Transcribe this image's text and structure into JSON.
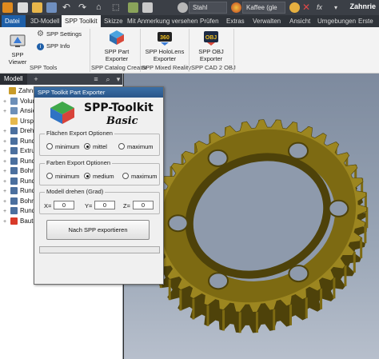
{
  "window": {
    "app_title": "Zahnrie",
    "material_value": "Stahl",
    "appearance_value": "Kaffee (gle"
  },
  "tabs": [
    {
      "label": "Datei"
    },
    {
      "label": "3D-Modell"
    },
    {
      "label": "SPP Toolkit"
    },
    {
      "label": "Skizze"
    },
    {
      "label": "Mit Anmerkung versehen"
    },
    {
      "label": "Prüfen"
    },
    {
      "label": "Extras"
    },
    {
      "label": "Verwalten"
    },
    {
      "label": "Ansicht"
    },
    {
      "label": "Umgebungen"
    },
    {
      "label": "Erste Sch"
    }
  ],
  "ribbon": {
    "spp_viewer": "SPP Viewer",
    "spp_settings": "SPP Settings",
    "spp_info": "SPP Info",
    "spp_part_exporter_1": "SPP Part",
    "spp_part_exporter_2": "Exporter",
    "spp_hololens_1": "SPP HoloLens",
    "spp_hololens_2": "Exporter",
    "spp_obj_1": "SPP OBJ",
    "spp_obj_2": "Exporter",
    "groups": {
      "tools": "SPP Tools",
      "catalog": "SPP Catalog Creator",
      "mixed": "SPP Mixed Reality",
      "cad": "SPP CAD 2 OBJ"
    }
  },
  "browser": {
    "tab_label": "Modell",
    "items": [
      {
        "label": "Zahnrie",
        "color": "#c89b2a"
      },
      {
        "label": "Volun",
        "color": "#6d8fb8"
      },
      {
        "label": "Ansich",
        "color": "#6d8fb8"
      },
      {
        "label": "Urspr",
        "color": "#e6b84c"
      },
      {
        "label": "Drehu",
        "color": "#4b6f9e"
      },
      {
        "label": "Rund",
        "color": "#4b6f9e"
      },
      {
        "label": "Extru",
        "color": "#4b6f9e"
      },
      {
        "label": "Rund",
        "color": "#4b6f9e"
      },
      {
        "label": "Bohru",
        "color": "#4b6f9e"
      },
      {
        "label": "Rund",
        "color": "#4b6f9e"
      },
      {
        "label": "Rund",
        "color": "#4b6f9e"
      },
      {
        "label": "Bohru",
        "color": "#4b6f9e"
      },
      {
        "label": "Rund",
        "color": "#4b6f9e"
      },
      {
        "label": "Baute",
        "color": "#d83a2a"
      }
    ]
  },
  "dialog": {
    "title": "SPP Toolkit Part Exporter",
    "brand": "SPP-Toolkit",
    "brand_sub": "Basic",
    "faces_group": "Flächen Export Optionen",
    "faces_options": [
      "minimum",
      "mittel",
      "maximum"
    ],
    "faces_selected": 1,
    "colors_group": "Farben Export Optionen",
    "colors_options": [
      "minimum",
      "medium",
      "maximum"
    ],
    "colors_selected": 1,
    "rotate_group": "Modell drehen (Grad)",
    "x_label": "X=",
    "y_label": "Y=",
    "z_label": "Z=",
    "x_value": "0",
    "y_value": "0",
    "z_value": "0",
    "export_button": "Nach SPP exportieren",
    "progress": 0
  },
  "colors": {
    "gear": "#7d6a12",
    "gear_light": "#9c8620",
    "gear_dark": "#4e420a",
    "accent": "#1e5fa8"
  }
}
